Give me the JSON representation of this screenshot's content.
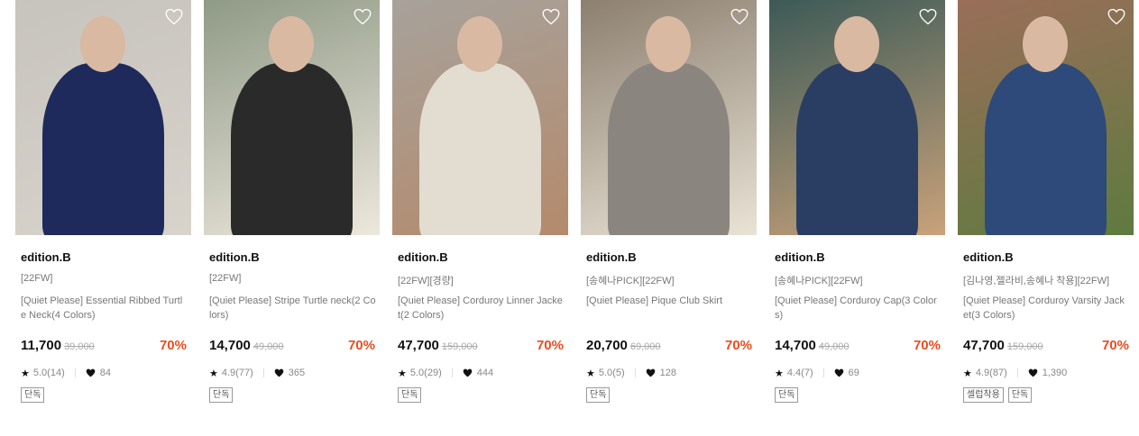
{
  "products": [
    {
      "brand": "edition.B",
      "tag": "[22FW]",
      "name": "[Quiet Please] Essential Ribbed Turtle Neck(4 Colors)",
      "price": "11,700",
      "original_price": "39,000",
      "discount": "70%",
      "rating": "5.0(14)",
      "likes": "84",
      "badges": [
        "단독"
      ],
      "colors": {
        "bg": "#c7c3bd",
        "figure": "#1d2a5b",
        "accent": "#d8d4cc"
      }
    },
    {
      "brand": "edition.B",
      "tag": "[22FW]",
      "name": "[Quiet Please] Stripe Turtle neck(2 Colors)",
      "price": "14,700",
      "original_price": "49,000",
      "discount": "70%",
      "rating": "4.9(77)",
      "likes": "365",
      "badges": [
        "단독"
      ],
      "colors": {
        "bg": "#8f9a86",
        "figure": "#2a2a2a",
        "accent": "#ede7dc"
      }
    },
    {
      "brand": "edition.B",
      "tag": "[22FW][경량]",
      "name": "[Quiet Please] Corduroy Linner Jacket(2 Colors)",
      "price": "47,700",
      "original_price": "159,000",
      "discount": "70%",
      "rating": "5.0(29)",
      "likes": "444",
      "badges": [
        "단독"
      ],
      "colors": {
        "bg": "#a7a29b",
        "figure": "#e2dcd1",
        "accent": "#b48a6c"
      }
    },
    {
      "brand": "edition.B",
      "tag": "[송혜나PICK][22FW]",
      "name": "[Quiet Please] Pique Club Skirt",
      "price": "20,700",
      "original_price": "69,000",
      "discount": "70%",
      "rating": "5.0(5)",
      "likes": "128",
      "badges": [
        "단독"
      ],
      "colors": {
        "bg": "#8c7f6f",
        "figure": "#8b8580",
        "accent": "#e9e3d6"
      }
    },
    {
      "brand": "edition.B",
      "tag": "[송혜나PICK][22FW]",
      "name": "[Quiet Please] Corduroy Cap(3 Colors)",
      "price": "14,700",
      "original_price": "49,000",
      "discount": "70%",
      "rating": "4.4(7)",
      "likes": "69",
      "badges": [
        "단독"
      ],
      "colors": {
        "bg": "#3c5a57",
        "figure": "#2a3e63",
        "accent": "#c9a27a"
      }
    },
    {
      "brand": "edition.B",
      "tag": "[김나영,젤라비,송혜나 착용][22FW]",
      "name": "[Quiet Please] Corduroy Varsity Jacket(3 Colors)",
      "price": "47,700",
      "original_price": "159,000",
      "discount": "70%",
      "rating": "4.9(87)",
      "likes": "1,390",
      "badges": [
        "셀럽착용",
        "단독"
      ],
      "colors": {
        "bg": "#9a6e5a",
        "figure": "#2d4a7a",
        "accent": "#5e7b3f"
      }
    }
  ]
}
